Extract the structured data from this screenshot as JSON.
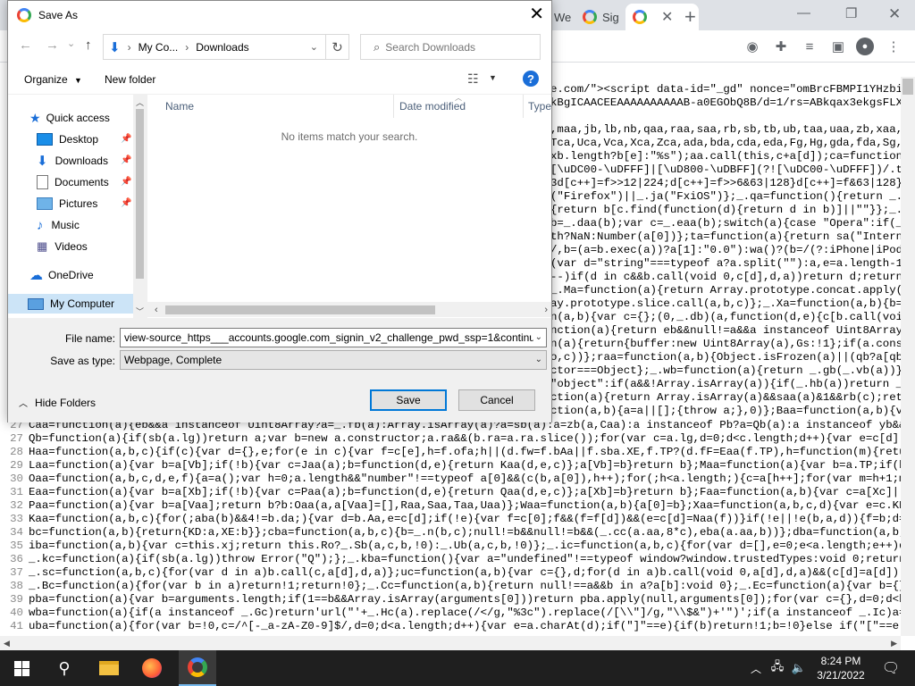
{
  "chrome": {
    "tabs": [
      {
        "label": "We"
      },
      {
        "label": "Sig"
      },
      {
        "label": ""
      }
    ],
    "new_tab": "+",
    "code_header_lines": [
      "e.com/\"><script data-id=\"_gd\" nonce=\"omBrcFBMPI1YHzbi9R",
      "kBgICAACEEAAAAAAAAAAB-a0EGObQ8B/d=1/rs=ABkqax3ekgsFLXaE"
    ],
    "code_right_lines": [
      ",maa,jb,lb,nb,qaa,raa,saa,rb,sb,tb,ub,taa,uaa,zb,xaa,w",
      "Tca,Uca,Vca,Xca,Zca,ada,bda,cda,eda,Fg,Hg,gda,fda,Sg,hd",
      "xb.length?b[e]:\"%s\");aa.call(this,c+a[d]);ca=function(",
      "[\\uDC00-\\uDFFF]|[\\uD800-\\uDBFF](?![\\uDC00-\\uDFFF])/.tes",
      "3d[c++]=f>>12|224;d[c++]=f>>6&63|128}d[c++]=f&63|128}}",
      "(\"Firefox\")||_.ja(\"FxiOS\")};_.qa=function(){return _.ja",
      "{return b[c.find(function(d){return d in b)]||\"\"}};_.",
      "b=_.daa(b);var c=_.eaa(b);switch(a){case \"Opera\":if(_.",
      "th?NaN:Number(a[0])};ta=function(a){return sa(\"Internet",
      "/,b=(a=b.exec(a))?a[1]:\"0.0\"):wa()?(b=/(?:iPhone|iPod|",
      "(var d=\"string\"===typeof a?a.split(\"\"):a,e=a.length-1;0",
      "--)if(d in c&&b.call(void 0,c[d],d,a))return d;return-1",
      "_.Ma=function(a){return Array.prototype.concat.apply(",
      "ay.prototype.slice.call(a,b,c)};_.Xa=function(a,b){b=b|",
      "n(a,b){var c={};(0,_.db)(a,function(d,e){c[b.call(void",
      "nction(a){return eb&&null!=a&&a instanceof Uint8Array};",
      "n(a){return{buffer:new Uint8Array(a),Gs:!1};if(a.constru",
      "o,c))};raa=function(a,b){Object.isFrozen(a)||(qb?a[qb]|",
      "ctor===Object};_.wb=function(a){return _.gb(_.vb(a))};_",
      "\"object\":if(a&&!Array.isArray(a)){if(_.hb(a))return _",
      "ction(a){return Array.isArray(a)&&saa(a)&1&&rb(c);return c};yaa=function(a){if",
      "ction(a,b){a=a||[];{throw a;},0)};Baa=function(a,b){var uaa(b"
    ],
    "code_numbered": [
      {
        "n": "27",
        "t": "Caa=function(a){eb&&a instanceof Uint8Array?a=_.fb(a):Array.isArray(a)?a=sb(a):a=zb(a,Caa):a instanceof Pb?a=Qb(a):a instanceof yb&&(a=A"
      },
      {
        "n": "27",
        "t": "Qb=function(a){if(sb(a.lg))return a;var b=new a.constructor;a.ra&&(b.ra=a.ra.slice());for(var c=a.lg,d=0;d<c.length;d++){var e=c[d];if(d"
      },
      {
        "n": "28",
        "t": "Haa=function(a,b,c){if(c){var d={},e;for(e in c){var f=c[e],h=f.ofa;h||(d.fw=f.bAa||f.sba.XE,f.TP?(d.fF=Eaa(f.TP),h=function(m){return f"
      },
      {
        "n": "29",
        "t": "Laa=function(a){var b=a[Vb];if(!b){var c=Jaa(a);b=function(d,e){return Kaa(d,e,c)};a[Vb]=b}return b};Maa=function(a){var b=a.TP;if(b)ret"
      },
      {
        "n": "30",
        "t": "Oaa=function(a,b,c,d,e,f){a=a();var h=0;a.length&&\"number\"!==typeof a[0]&&(c(b,a[0]),h++);for(;h<a.length;){c=a[h++];for(var m=h+1;m<a.l"
      },
      {
        "n": "31",
        "t": "Eaa=function(a){var b=a[Xb];if(!b){var c=Paa(a);b=function(d,e){return Qaa(d,e,c)};a[Xb]=b}return b};Faa=function(a,b){var c=a[Xc]||(c"
      },
      {
        "n": "32",
        "t": "Paa=function(a){var b=a[Vaa];return b?b:Oaa(a,a[Vaa]=[],Raa,Saa,Taa,Uaa)};Waa=function(a,b){a[0]=b};Xaa=function(a,b,c,d){var e=c.KD;a[b"
      },
      {
        "n": "33",
        "t": "Kaa=function(a,b,c){for(;aba(b)&&4!=b.da;){var d=b.Aa,e=c[d];if(!e){var f=c[0];f&&(f=f[d])&&(e=c[d]=Naa(f))}if(!e||!e(b,a,d)){f=b;d=a;e="
      },
      {
        "n": "34",
        "t": "bc=function(a,b){return{KD:a,XE:b}};cba=function(a,b,c){b=_.n(b,c);null!=b&&null!=b&&(_.cc(a.aa,8*c),eba(a.aa,b))};dba=function(a,b,c){b"
      },
      {
        "n": "35",
        "t": "iba=function(a,b){var c=this.xj;return this.Ro?_.Sb(a,c,b,!0):_.Ub(a,c,b,!0)};_.ic=function(a,b,c){for(var d=[],e=0;e<a.length;e++)d.pus"
      },
      {
        "n": "36",
        "t": "_.kc=function(a){if(sb(a.lg))throw Error(\"Q\");};_.kba=function(){var a=\"undefined\"!==typeof window?window.trustedTypes:void 0;return nul"
      },
      {
        "n": "37",
        "t": "_.sc=function(a,b,c){for(var d in a)b.call(c,a[d],d,a)};uc=function(a,b){var c={},d;for(d in a)b.call(void 0,a[d],d,a)&&(c[d]=a[d]);retu"
      },
      {
        "n": "38",
        "t": "_.Bc=function(a){for(var b in a)return!1;return!0};_.Cc=function(a,b){return null!==a&&b in a?a[b]:void 0};_.Ec=function(a){var b={},c;f"
      },
      {
        "n": "39",
        "t": "pba=function(a){var b=arguments.length;if(1==b&&Array.isArray(arguments[0]))return pba.apply(null,arguments[0]);for(var c={},d=0;d<b;d++"
      },
      {
        "n": "40",
        "t": "wba=function(a){if(a instanceof _.Gc)return'url(\"'+_.Hc(a).replace(/</g,\"%3c\").replace(/[\\\\\"]/g,\"\\\\$&\")+'\")';if(a instanceof _.Ic)a=_.Jc"
      },
      {
        "n": "41",
        "t": "uba=function(a){for(var b=!0,c=/^[-_a-zA-Z0-9]$/,d=0;d<a.length;d++){var e=a.charAt(d);if(\"]\"==e){if(b)return!1;b=!0}else if(\"[\"==e){if("
      }
    ]
  },
  "dialog": {
    "title": "Save As",
    "breadcrumb": [
      "My Co...",
      "Downloads"
    ],
    "search_placeholder": "Search Downloads",
    "organize": "Organize",
    "new_folder": "New folder",
    "help": "?",
    "nav": {
      "quick_access": "Quick access",
      "items": [
        {
          "label": "Desktop",
          "pinned": true
        },
        {
          "label": "Downloads",
          "pinned": true
        },
        {
          "label": "Documents",
          "pinned": true
        },
        {
          "label": "Pictures",
          "pinned": true
        },
        {
          "label": "Music",
          "pinned": false
        },
        {
          "label": "Videos",
          "pinned": false
        }
      ],
      "onedrive": "OneDrive",
      "my_computer": "My Computer"
    },
    "columns": {
      "name": "Name",
      "date": "Date modified",
      "type": "Type"
    },
    "empty_message": "No items match your search.",
    "file_name_label": "File name:",
    "file_name_value": "view-source_https___accounts.google.com_signin_v2_challenge_pwd_ssp=1&continue",
    "save_type_label": "Save as type:",
    "save_type_value": "Webpage, Complete",
    "hide_folders": "Hide Folders",
    "save": "Save",
    "cancel": "Cancel"
  },
  "taskbar": {
    "time": "8:24 PM",
    "date": "3/21/2022"
  }
}
